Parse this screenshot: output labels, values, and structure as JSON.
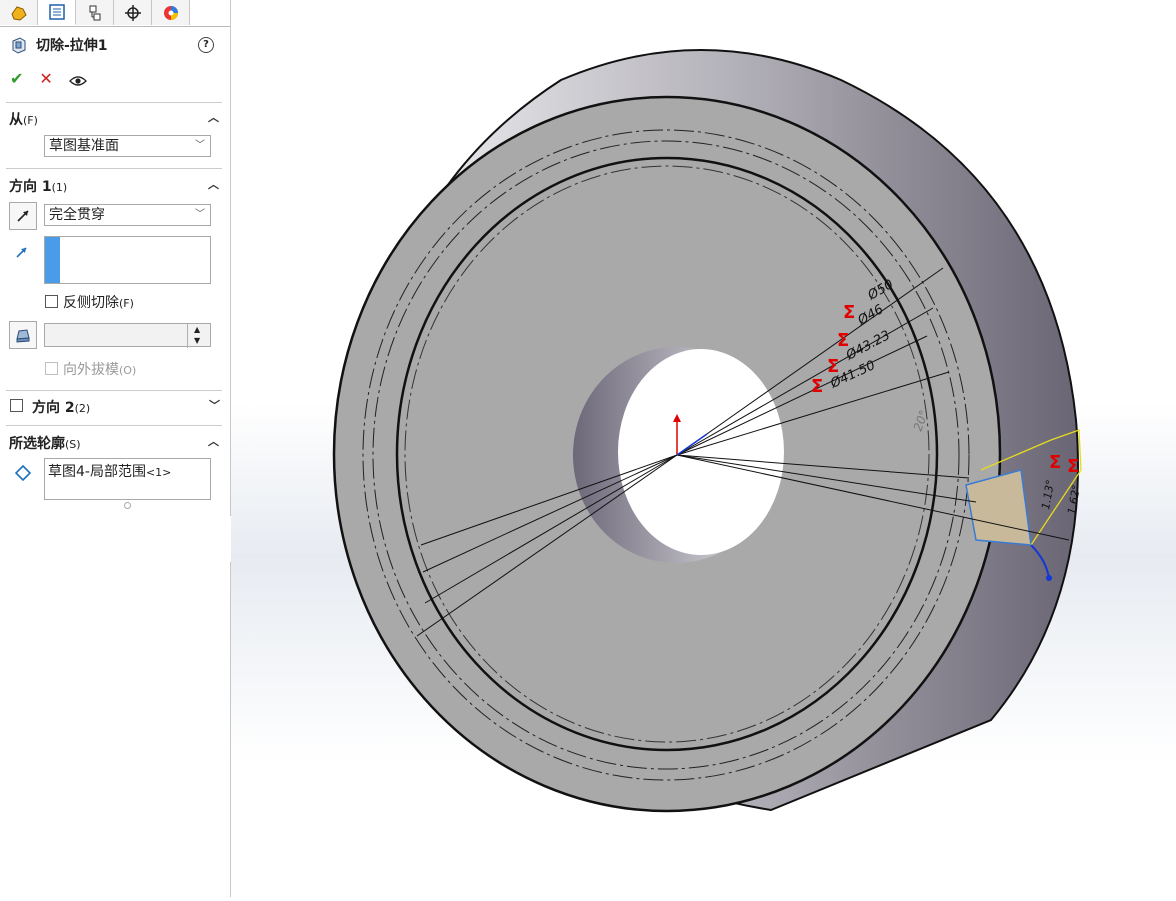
{
  "feature": {
    "title": "切除-拉伸1",
    "help_label": "?"
  },
  "actions": {
    "ok_label": "✔",
    "cancel_label": "✕",
    "preview_label": "👁"
  },
  "from": {
    "header": "从",
    "header_key": "(F)",
    "selected": "草图基准面"
  },
  "direction1": {
    "header": "方向 1",
    "header_key": "(1)",
    "end_condition": "完全贯穿",
    "flip_cut_label": "反侧切除",
    "flip_cut_key": "(F)",
    "flip_cut_checked": false,
    "draft_outward_label": "向外拔模",
    "draft_outward_key": "(O)",
    "draft_outward_enabled": false
  },
  "direction2": {
    "header": "方向 2",
    "header_key": "(2)",
    "checked": false
  },
  "selected_contours": {
    "header": "所选轮廓",
    "header_key": "(S)",
    "item_main": "草图4-局部范围",
    "item_suffix": "<1>"
  },
  "dimensions": {
    "d1": "Ø50",
    "d2": "Ø46",
    "d3": "Ø43.23",
    "d4": "Ø41.50",
    "angle": "20°",
    "r1": "1.13°",
    "r2": "1.62°"
  },
  "colors": {
    "accent_blue": "#4a90e2",
    "ok_green": "#2e9a2e",
    "cancel_red": "#d02020",
    "dimension_red": "#e00000"
  }
}
